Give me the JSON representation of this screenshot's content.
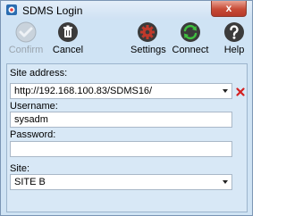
{
  "window": {
    "title": "SDMS Login",
    "close_label": "x"
  },
  "toolbar": {
    "confirm_label": "Confirm",
    "cancel_label": "Cancel",
    "settings_label": "Settings",
    "connect_label": "Connect",
    "help_label": "Help"
  },
  "form": {
    "site_address_label": "Site address:",
    "site_address_value": "http://192.168.100.83/SDMS16/",
    "username_label": "Username:",
    "username_value": "sysadm",
    "password_label": "Password:",
    "password_value": "",
    "site_label": "Site:",
    "site_value": "SITE B"
  },
  "colors": {
    "window_bg": "#cfe3f4",
    "form_bg": "#d8e8f6",
    "clear_icon": "#d42020",
    "settings_icon": "#c0392b",
    "connect_icon": "#2e8b2e"
  },
  "icons": {
    "app": "sdms-app-icon",
    "confirm": "checkmark-icon",
    "cancel": "trash-icon",
    "settings": "gear-icon",
    "connect": "connect-arrows-icon",
    "help": "question-icon",
    "clear": "red-x-icon"
  }
}
